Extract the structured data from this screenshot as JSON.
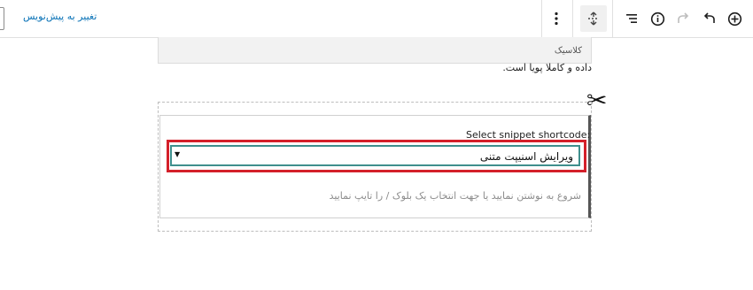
{
  "toolbar": {
    "switch_to_draft": "تغییر به پیش‌نویس",
    "icons": {
      "add": "plus-circle-icon",
      "undo": "undo-icon",
      "redo": "redo-icon",
      "details": "info-icon",
      "outline": "list-view-icon",
      "transform": "transform-icon",
      "more": "more-vertical-icon"
    }
  },
  "classic_block": {
    "label": "کلاسیک",
    "content": "داده و کاملا پویا است."
  },
  "snippet_block": {
    "icon": "scissors-icon",
    "label": "Select snippet shortcode:",
    "select_value": "ویرایش اسنیپت متنی",
    "placeholder": "شروع به نوشتن نمایید یا جهت انتخاب یک بلوک / را تایپ نمایید"
  },
  "colors": {
    "highlight": "#d4202a",
    "select_border": "#3f8f8d",
    "link": "#0b73b7"
  }
}
